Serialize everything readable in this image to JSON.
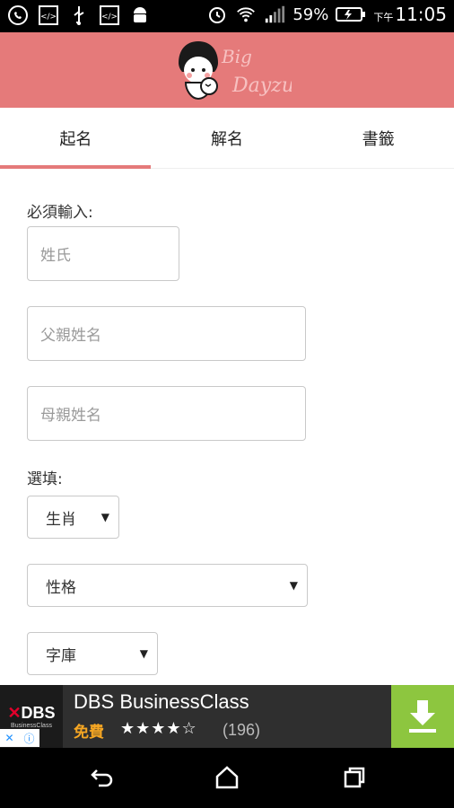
{
  "status_bar": {
    "icons_left": [
      "whatsapp-icon",
      "code-icon",
      "usb-icon",
      "code-icon",
      "android-icon"
    ],
    "icons_right": [
      "alarm-icon",
      "wifi-icon",
      "signal-icon",
      "battery-icon"
    ],
    "battery": "59%",
    "ampm": "下午",
    "time": "11:05"
  },
  "header": {
    "logo_text": "Big Dayzu"
  },
  "tabs": [
    {
      "label": "起名",
      "active": true
    },
    {
      "label": "解名",
      "active": false
    },
    {
      "label": "書籤",
      "active": false
    }
  ],
  "form": {
    "required_label": "必須輸入:",
    "surname_placeholder": "姓氏",
    "father_placeholder": "父親姓名",
    "mother_placeholder": "母親姓名",
    "optional_label": "選填:",
    "zodiac_value": "生肖",
    "personality_value": "性格",
    "dictionary_value": "字庫",
    "caret": "▼"
  },
  "ad": {
    "brand": "DBS",
    "brand_mark": "✕",
    "brand_sub": "BusinessClass",
    "title": "DBS BusinessClass",
    "free": "免費",
    "stars": "★★★★☆",
    "rating_count": "(196)",
    "choices_x": "✕",
    "choices_i": "ⓘ"
  },
  "colors": {
    "accent": "#e57a7a",
    "download": "#8dc63f",
    "ad_free": "#f5a623"
  }
}
